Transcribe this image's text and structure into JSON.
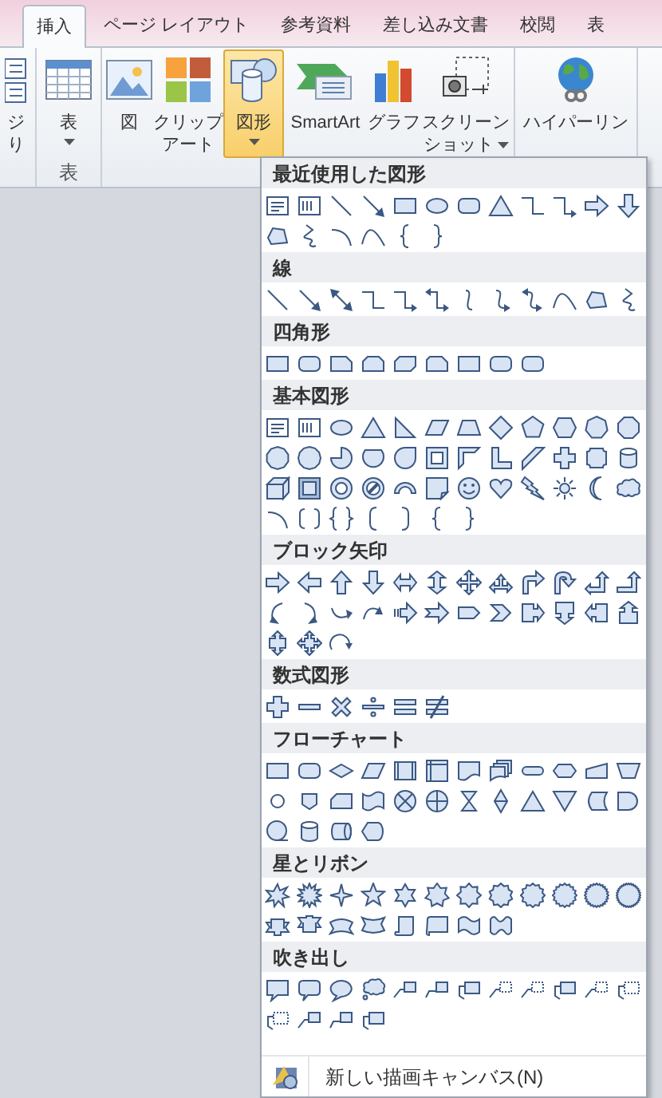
{
  "tabs": [
    {
      "label": "挿入",
      "selected": true
    },
    {
      "label": "ページ レイアウト",
      "selected": false
    },
    {
      "label": "参考資料",
      "selected": false
    },
    {
      "label": "差し込み文書",
      "selected": false
    },
    {
      "label": "校閲",
      "selected": false
    },
    {
      "label": "表",
      "selected": false
    }
  ],
  "ribbon": {
    "groups": [
      {
        "buttons": [
          {
            "kind": "page",
            "lines": [
              "ジ",
              "り"
            ],
            "dropdown": false,
            "selected": false
          }
        ]
      },
      {
        "label": "表",
        "buttons": [
          {
            "kind": "table",
            "lines": [
              "表"
            ],
            "dropdown": true,
            "selected": false
          }
        ]
      },
      {
        "buttons": [
          {
            "kind": "picture",
            "lines": [
              "図"
            ],
            "dropdown": false,
            "selected": false
          },
          {
            "kind": "clipart",
            "lines": [
              "クリップ",
              "アート"
            ],
            "dropdown": false,
            "selected": false
          },
          {
            "kind": "shapes",
            "lines": [
              "図形"
            ],
            "dropdown": true,
            "selected": true
          },
          {
            "kind": "smartart",
            "lines": [
              "SmartArt"
            ],
            "dropdown": false,
            "selected": false
          },
          {
            "kind": "chart",
            "lines": [
              "グラフ"
            ],
            "dropdown": false,
            "selected": false
          },
          {
            "kind": "screenshot",
            "lines": [
              "スクリーン",
              "ショット"
            ],
            "dropdown": true,
            "selected": false
          }
        ]
      },
      {
        "buttons": [
          {
            "kind": "hyperlink",
            "lines": [
              "ハイパーリン"
            ],
            "dropdown": false,
            "selected": false
          }
        ]
      }
    ]
  },
  "menu": {
    "sections": [
      {
        "title": "最近使用した図形"
      },
      {
        "title": "線"
      },
      {
        "title": "四角形"
      },
      {
        "title": "基本図形"
      },
      {
        "title": "ブロック矢印"
      },
      {
        "title": "数式図形"
      },
      {
        "title": "フローチャート"
      },
      {
        "title": "星とリボン"
      },
      {
        "title": "吹き出し"
      }
    ],
    "footer": {
      "label": "新しい描画キャンバス(N)"
    }
  }
}
